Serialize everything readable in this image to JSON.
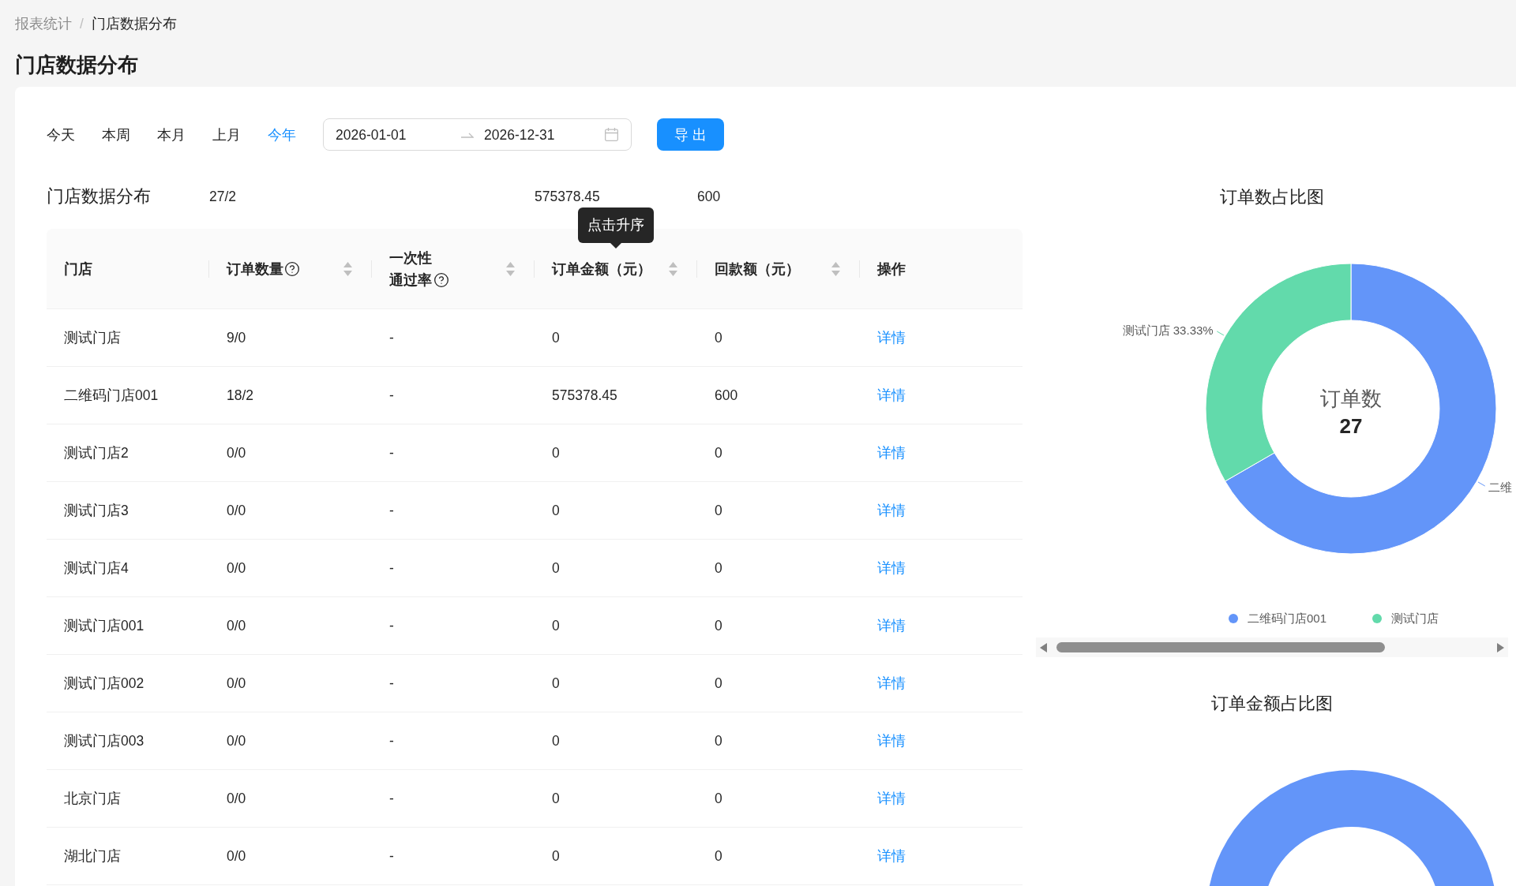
{
  "breadcrumb": {
    "separator": "/",
    "items": [
      {
        "label": "报表统计",
        "current": false
      },
      {
        "label": "门店数据分布",
        "current": true
      }
    ]
  },
  "page_title": "门店数据分布",
  "quick_filters": [
    {
      "label": "今天",
      "selected": false
    },
    {
      "label": "本周",
      "selected": false
    },
    {
      "label": "本月",
      "selected": false
    },
    {
      "label": "上月",
      "selected": false
    },
    {
      "label": "今年",
      "selected": true
    }
  ],
  "date_range": {
    "start": "2026-01-01",
    "end": "2026-12-31"
  },
  "export_button": "导 出",
  "summary": {
    "title": "门店数据分布",
    "order_count": "27/2",
    "order_amount": "575378.45",
    "refund_amount": "600"
  },
  "table": {
    "columns": [
      {
        "label": "门店",
        "help_icon": false,
        "sortable": false
      },
      {
        "label": "订单数量",
        "help_icon": true,
        "sortable": true
      },
      {
        "label": "一次性通过率",
        "help_icon": true,
        "sortable": true
      },
      {
        "label": "订单金额（元）",
        "help_icon": false,
        "sortable": true,
        "tooltip": "点击升序"
      },
      {
        "label": "回款额（元）",
        "help_icon": false,
        "sortable": true
      },
      {
        "label": "操作",
        "help_icon": false,
        "sortable": false
      }
    ],
    "rows": [
      {
        "cells": [
          "测试门店",
          "9/0",
          "-",
          "0",
          "0"
        ],
        "action": "详情"
      },
      {
        "cells": [
          "二维码门店001",
          "18/2",
          "-",
          "575378.45",
          "600"
        ],
        "action": "详情"
      },
      {
        "cells": [
          "测试门店2",
          "0/0",
          "-",
          "0",
          "0"
        ],
        "action": "详情"
      },
      {
        "cells": [
          "测试门店3",
          "0/0",
          "-",
          "0",
          "0"
        ],
        "action": "详情"
      },
      {
        "cells": [
          "测试门店4",
          "0/0",
          "-",
          "0",
          "0"
        ],
        "action": "详情"
      },
      {
        "cells": [
          "测试门店001",
          "0/0",
          "-",
          "0",
          "0"
        ],
        "action": "详情"
      },
      {
        "cells": [
          "测试门店002",
          "0/0",
          "-",
          "0",
          "0"
        ],
        "action": "详情"
      },
      {
        "cells": [
          "测试门店003",
          "0/0",
          "-",
          "0",
          "0"
        ],
        "action": "详情"
      },
      {
        "cells": [
          "北京门店",
          "0/0",
          "-",
          "0",
          "0"
        ],
        "action": "详情"
      },
      {
        "cells": [
          "湖北门店",
          "0/0",
          "-",
          "0",
          "0"
        ],
        "action": "详情"
      }
    ]
  },
  "order_count_chart": {
    "center_label": "订单数",
    "center_value": "27",
    "slices": [
      {
        "label": "二维",
        "color": "#6395f9"
      },
      {
        "label": "测试门店 33.33%",
        "color": "#62daab"
      }
    ],
    "chart_data": {
      "type": "donut",
      "title": "订单数占比图",
      "categories": [
        "二维码门店001",
        "测试门店"
      ],
      "values": [
        66.67,
        33.33
      ],
      "legend": "bottom"
    }
  },
  "order_amount_chart": {
    "title": "订单金额占比图"
  }
}
